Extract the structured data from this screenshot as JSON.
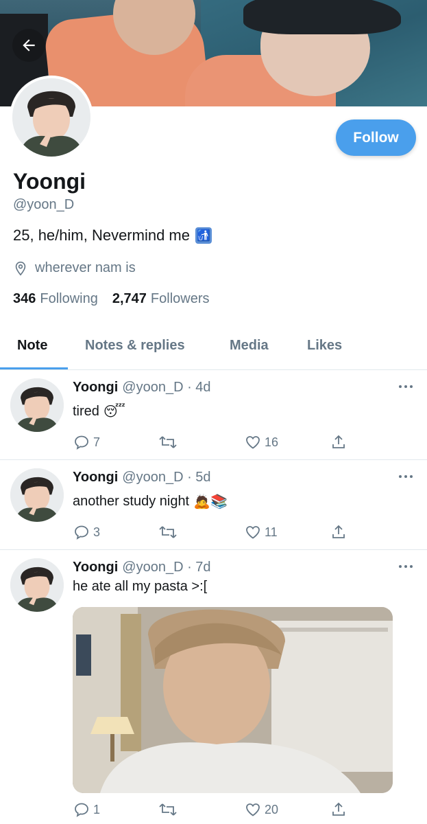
{
  "profile": {
    "display_name": "Yoongi",
    "handle": "@yoon_D",
    "bio": "25, he/him, Nevermind me",
    "bio_emoji": "🚮",
    "location": "wherever nam is",
    "following_count": "346",
    "following_label": "Following",
    "followers_count": "2,747",
    "followers_label": "Followers",
    "follow_button": "Follow"
  },
  "tabs": [
    {
      "label": "Note",
      "active": true
    },
    {
      "label": "Notes & replies",
      "active": false
    },
    {
      "label": "Media",
      "active": false
    },
    {
      "label": "Likes",
      "active": false
    }
  ],
  "tweets": [
    {
      "name": "Yoongi",
      "meta": "@yoon_D · 4d",
      "text": "tired",
      "emoji": "😴",
      "replies": "7",
      "retweets": "",
      "likes": "16"
    },
    {
      "name": "Yoongi",
      "meta": "@yoon_D · 5d",
      "text": "another study night",
      "emoji": "🙇📚",
      "replies": "3",
      "retweets": "",
      "likes": "11"
    },
    {
      "name": "Yoongi",
      "meta": "@yoon_D · 7d",
      "text": "he ate all my pasta >:[",
      "emoji": "",
      "replies": "1",
      "retweets": "",
      "likes": "20",
      "has_media": true
    }
  ],
  "colors": {
    "accent": "#4a9fec",
    "text_primary": "#14171a",
    "text_secondary": "#657786",
    "divider": "#e1e8ed"
  },
  "icons": {
    "back": "arrow-left-icon",
    "location": "location-pin-icon",
    "reply": "reply-icon",
    "retweet": "retweet-icon",
    "like": "heart-icon",
    "share": "share-icon",
    "more": "more-dots-icon"
  }
}
